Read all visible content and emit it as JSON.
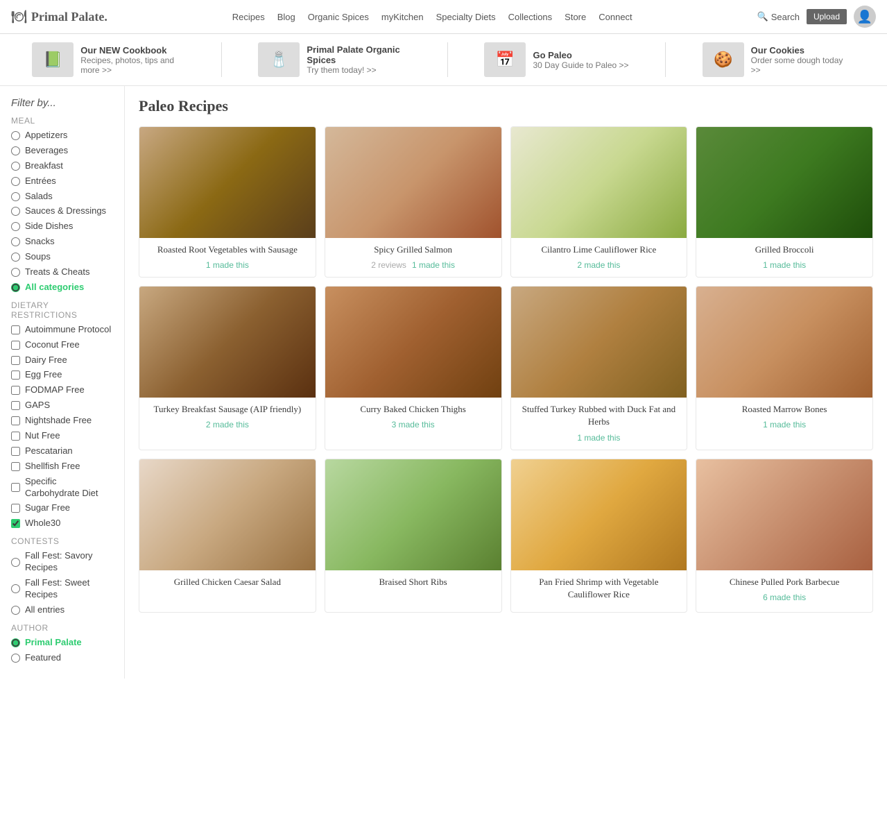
{
  "site": {
    "logo": "Primal Palate.",
    "nav": [
      "Recipes",
      "Blog",
      "Organic Spices",
      "myKitchen",
      "Specialty Diets",
      "Collections",
      "Store",
      "Connect"
    ],
    "search_label": "Search",
    "upload_label": "Upload"
  },
  "promo": [
    {
      "icon": "📗",
      "title": "Our NEW Cookbook",
      "sub": "Recipes, photos, tips and more >>"
    },
    {
      "icon": "🧂",
      "title": "Primal Palate Organic Spices",
      "sub": "Try them today! >>"
    },
    {
      "icon": "📅",
      "title": "Go Paleo",
      "sub": "30 Day Guide to Paleo >>"
    },
    {
      "icon": "🍪",
      "title": "Our Cookies",
      "sub": "Order some dough today >>"
    }
  ],
  "sidebar": {
    "filter_title": "Filter by...",
    "meal_label": "Meal",
    "meal_items": [
      {
        "id": "appetizers",
        "label": "Appetizers",
        "checked": false
      },
      {
        "id": "beverages",
        "label": "Beverages",
        "checked": false
      },
      {
        "id": "breakfast",
        "label": "Breakfast",
        "checked": false
      },
      {
        "id": "entrees",
        "label": "Entrées",
        "checked": false
      },
      {
        "id": "salads",
        "label": "Salads",
        "checked": false
      },
      {
        "id": "sauces",
        "label": "Sauces & Dressings",
        "checked": false
      },
      {
        "id": "side-dishes",
        "label": "Side Dishes",
        "checked": false
      },
      {
        "id": "snacks",
        "label": "Snacks",
        "checked": false
      },
      {
        "id": "soups",
        "label": "Soups",
        "checked": false
      },
      {
        "id": "treats",
        "label": "Treats & Cheats",
        "checked": false
      },
      {
        "id": "all-categories",
        "label": "All categories",
        "checked": true
      }
    ],
    "dietary_label": "Dietary Restrictions",
    "dietary_items": [
      {
        "id": "autoimmune",
        "label": "Autoimmune Protocol",
        "checked": false
      },
      {
        "id": "coconut-free",
        "label": "Coconut Free",
        "checked": false
      },
      {
        "id": "dairy-free",
        "label": "Dairy Free",
        "checked": false
      },
      {
        "id": "egg-free",
        "label": "Egg Free",
        "checked": false
      },
      {
        "id": "fodmap-free",
        "label": "FODMAP Free",
        "checked": false
      },
      {
        "id": "gaps",
        "label": "GAPS",
        "checked": false
      },
      {
        "id": "nightshade-free",
        "label": "Nightshade Free",
        "checked": false
      },
      {
        "id": "nut-free",
        "label": "Nut Free",
        "checked": false
      },
      {
        "id": "pescatarian",
        "label": "Pescatarian",
        "checked": false
      },
      {
        "id": "shellfish-free",
        "label": "Shellfish Free",
        "checked": false
      },
      {
        "id": "scd",
        "label": "Specific Carbohydrate Diet",
        "checked": false
      },
      {
        "id": "sugar-free",
        "label": "Sugar Free",
        "checked": false
      },
      {
        "id": "whole30",
        "label": "Whole30",
        "checked": true
      }
    ],
    "contests_label": "Contests",
    "contest_items": [
      {
        "id": "fall-savory",
        "label": "Fall Fest: Savory Recipes",
        "checked": false
      },
      {
        "id": "fall-sweet",
        "label": "Fall Fest: Sweet Recipes",
        "checked": false
      },
      {
        "id": "all-entries",
        "label": "All entries",
        "checked": false
      }
    ],
    "author_label": "Author",
    "author_items": [
      {
        "id": "primal-palate",
        "label": "Primal Palate",
        "checked": true
      },
      {
        "id": "featured",
        "label": "Featured",
        "checked": false
      }
    ]
  },
  "content": {
    "page_title": "Paleo Recipes",
    "recipes": [
      {
        "name": "Roasted Root Vegetables with Sausage",
        "reviews": null,
        "made_this": "1 made this",
        "img_class": "img-1"
      },
      {
        "name": "Spicy Grilled Salmon",
        "reviews": "2 reviews",
        "made_this": "1 made this",
        "img_class": "img-2"
      },
      {
        "name": "Cilantro Lime Cauliflower Rice",
        "reviews": null,
        "made_this": "2 made this",
        "img_class": "img-3"
      },
      {
        "name": "Grilled Broccoli",
        "reviews": null,
        "made_this": "1 made this",
        "img_class": "img-4"
      },
      {
        "name": "Turkey Breakfast Sausage (AIP friendly)",
        "reviews": null,
        "made_this": "2 made this",
        "img_class": "img-5"
      },
      {
        "name": "Curry Baked Chicken Thighs",
        "reviews": null,
        "made_this": "3 made this",
        "img_class": "img-6"
      },
      {
        "name": "Stuffed Turkey Rubbed with Duck Fat and Herbs",
        "reviews": null,
        "made_this": "1 made this",
        "img_class": "img-7"
      },
      {
        "name": "Roasted Marrow Bones",
        "reviews": null,
        "made_this": "1 made this",
        "img_class": "img-8"
      },
      {
        "name": "Grilled Chicken Caesar Salad",
        "reviews": null,
        "made_this": null,
        "img_class": "img-9"
      },
      {
        "name": "Braised Short Ribs",
        "reviews": null,
        "made_this": null,
        "img_class": "img-10"
      },
      {
        "name": "Pan Fried Shrimp with Vegetable Cauliflower Rice",
        "reviews": null,
        "made_this": null,
        "img_class": "img-11"
      },
      {
        "name": "Chinese Pulled Pork Barbecue",
        "reviews": null,
        "made_this": "6 made this",
        "img_class": "img-12"
      }
    ]
  }
}
